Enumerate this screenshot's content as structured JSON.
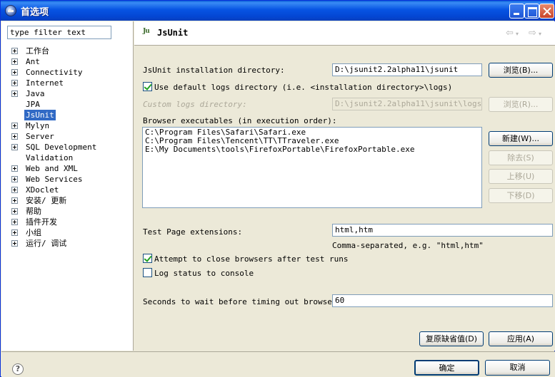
{
  "window": {
    "title": "首选项"
  },
  "filter": {
    "value": "type filter text"
  },
  "tree": [
    {
      "label": "工作台",
      "expandable": true
    },
    {
      "label": "Ant",
      "expandable": true
    },
    {
      "label": "Connectivity",
      "expandable": true
    },
    {
      "label": "Internet",
      "expandable": true
    },
    {
      "label": "Java",
      "expandable": true
    },
    {
      "label": "JPA",
      "expandable": false
    },
    {
      "label": "JsUnit",
      "expandable": false,
      "selected": true
    },
    {
      "label": "Mylyn",
      "expandable": true
    },
    {
      "label": "Server",
      "expandable": true
    },
    {
      "label": "SQL Development",
      "expandable": true
    },
    {
      "label": "Validation",
      "expandable": false
    },
    {
      "label": "Web and XML",
      "expandable": true
    },
    {
      "label": "Web Services",
      "expandable": true
    },
    {
      "label": "XDoclet",
      "expandable": true
    },
    {
      "label": "安装/ 更新",
      "expandable": true
    },
    {
      "label": "帮助",
      "expandable": true
    },
    {
      "label": "插件开发",
      "expandable": true
    },
    {
      "label": "小组",
      "expandable": true
    },
    {
      "label": "运行/ 调试",
      "expandable": true
    }
  ],
  "page": {
    "icon_text": "Ju",
    "title": "JsUnit",
    "install_dir": {
      "label": "JsUnit installation directory:",
      "value": "D:\\jsunit2.2alpha11\\jsunit",
      "browse": "浏览(B)..."
    },
    "default_logs": {
      "label": "Use default logs directory (i.e. <installation directory>\\logs)",
      "checked": true
    },
    "custom_logs": {
      "label": "Custom logs directory:",
      "value": "D:\\jsunit2.2alpha11\\jsunit\\logs",
      "browse": "浏览(R)..."
    },
    "browsers": {
      "label": "Browser executables (in execution order):",
      "items": [
        "C:\\Program Files\\Safari\\Safari.exe",
        "C:\\Program Files\\Tencent\\TT\\TTraveler.exe",
        "E:\\My Documents\\tools\\FirefoxPortable\\FirefoxPortable.exe"
      ],
      "new_btn": "新建(W)...",
      "remove_btn": "除去(S)",
      "up_btn": "上移(U)",
      "down_btn": "下移(D)"
    },
    "extensions": {
      "label": "Test Page extensions:",
      "value": "html,htm",
      "hint": "Comma-separated, e.g. \"html,htm\""
    },
    "attempt_close": {
      "label": "Attempt to close browsers after test runs",
      "checked": true
    },
    "log_status": {
      "label": "Log status to console",
      "checked": false
    },
    "timeout": {
      "label": "Seconds to wait before timing out browsers:",
      "value": "60"
    },
    "restore_defaults": "复原缺省值(D)",
    "apply": "应用(A)"
  },
  "footer": {
    "ok": "确定",
    "cancel": "取消"
  },
  "icons": {
    "help": "?"
  }
}
